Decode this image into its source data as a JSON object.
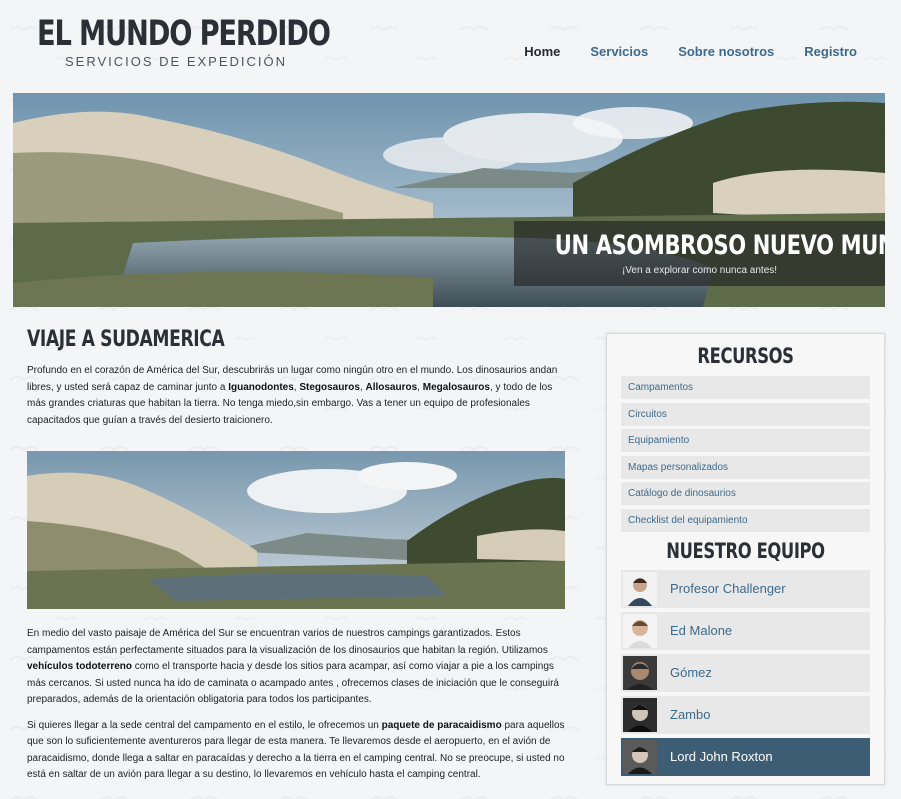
{
  "logo": {
    "title": "EL MUNDO PERDIDO",
    "subtitle": "SERVICIOS DE EXPEDICIÓN"
  },
  "nav": [
    {
      "label": "Home",
      "active": true
    },
    {
      "label": "Servicios"
    },
    {
      "label": "Sobre nosotros"
    },
    {
      "label": "Registro"
    }
  ],
  "hero": {
    "title": "UN ASOMBROSO NUEVO MUNDO",
    "subtitle": "¡Ven a explorar como nunca antes!"
  },
  "main": {
    "heading": "VIAJE A SUDAMERICA",
    "p1": {
      "a": "Profundo en el corazón de América del Sur, descubrirás un lugar como ningún otro en el mundo. Los dinosaurios andan libres, y usted será capaz de caminar junto a ",
      "b1": "Iguanodontes",
      "s1": ", ",
      "b2": "Stegosauros",
      "s2": ", ",
      "b3": "Allosauros",
      "s3": ", ",
      "b4": "Megalosauros",
      "c": ", y todo de los más grandes criaturas que habitan la tierra. No tenga miedo,sin embargo. Vas a tener un equipo de profesionales capacitados que guían a través del desierto traicionero."
    },
    "p2": {
      "a": "En medio del vasto paisaje de América del Sur se encuentran varios de nuestros campings garantizados. Estos campamentos están perfectamente situados para la visualización de los dinosaurios que habitan la región. Utilizamos ",
      "b": "vehículos todoterreno",
      "c": " como el transporte hacia y desde los sitios para acampar, así como viajar a pie a los campings más cercanos. Si usted nunca ha ido de caminata o acampado antes , ofrecemos clases de iniciación que le conseguirá preparados, además de la orientación obligatoria para todos los participantes."
    },
    "p3": {
      "a": "Si quieres llegar a la sede central del campamento en el estilo, le ofrecemos un ",
      "b": "paquete de paracaidismo",
      "c": " para aquellos que son lo suficientemente aventureros para llegar de esta manera. Te llevaremos desde el aeropuerto, en el avión de paracaidismo, donde llega a saltar en paracaídas y derecho a la tierra en el camping central. No se preocupe, si usted no está en saltar de un avión para llegar a su destino, lo llevaremos en vehículo hasta el camping central."
    }
  },
  "sidebar": {
    "resources_title": "RECURSOS",
    "resources": [
      "Campamentos",
      "Circuitos",
      "Equipamiento",
      "Mapas personalizados",
      "Catálogo de dinosaurios",
      "Checklist del equipamiento"
    ],
    "team_title": "NUESTRO EQUIPO",
    "team": [
      {
        "name": "Profesor Challenger"
      },
      {
        "name": "Ed Malone"
      },
      {
        "name": "Gómez"
      },
      {
        "name": "Zambo"
      },
      {
        "name": "Lord John Roxton",
        "active": true
      }
    ]
  },
  "colors": {
    "link": "#3d6a8c",
    "active_member": "#3c5d73",
    "heading": "#2a3036"
  }
}
